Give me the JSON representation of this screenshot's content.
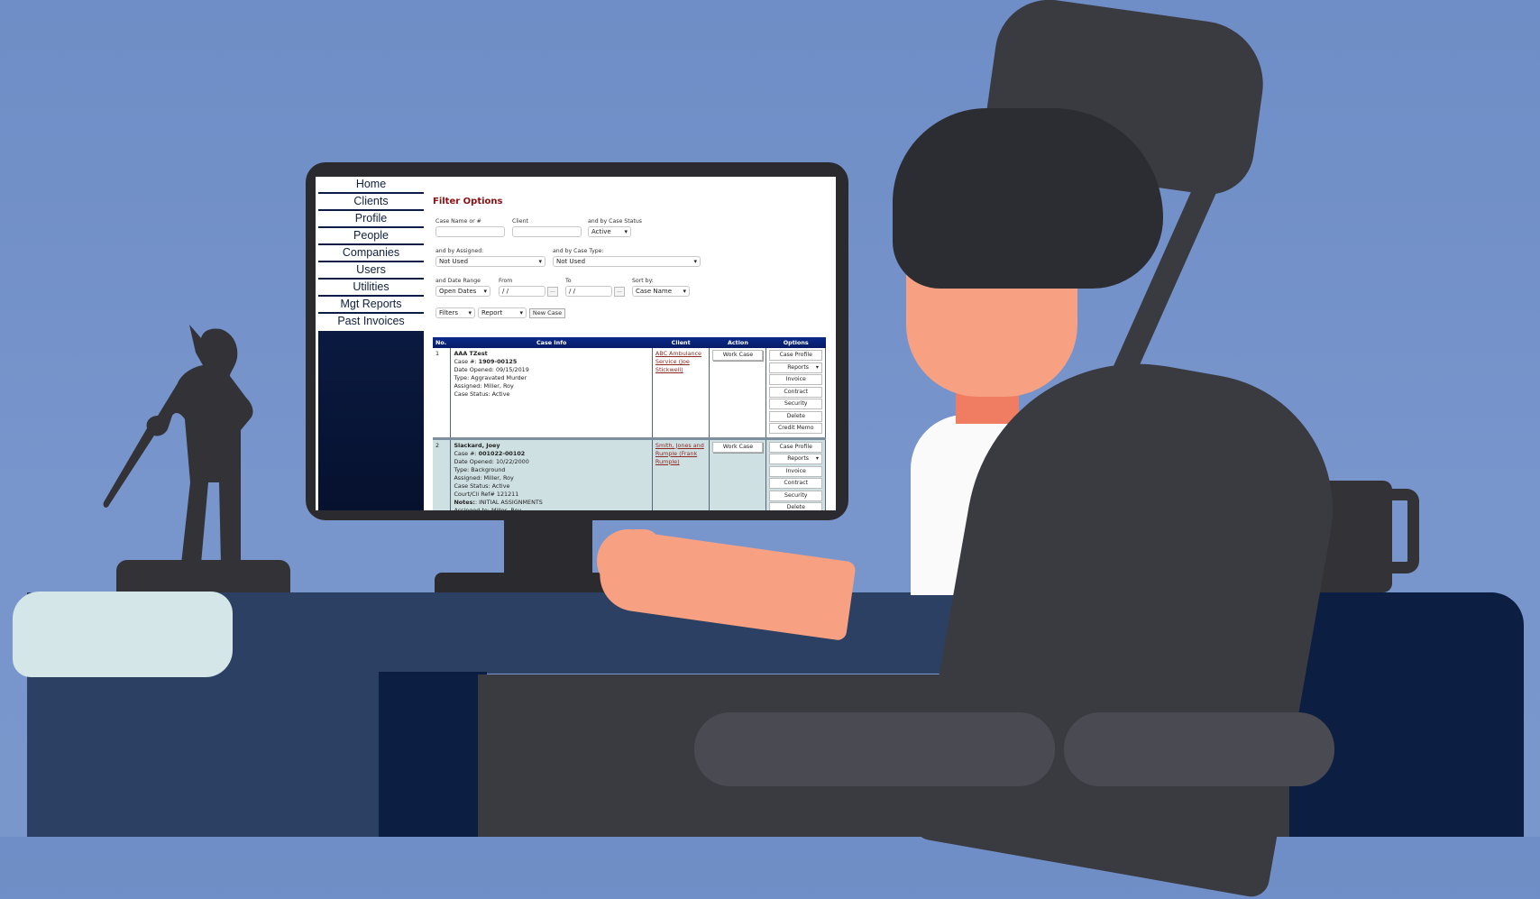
{
  "sidebar": {
    "items": [
      {
        "label": "Home"
      },
      {
        "label": "Clients"
      },
      {
        "label": "Profile"
      },
      {
        "label": "People"
      },
      {
        "label": "Companies"
      },
      {
        "label": "Users"
      },
      {
        "label": "Utilities"
      },
      {
        "label": "Mgt Reports"
      },
      {
        "label": "Past Invoices"
      }
    ]
  },
  "filters": {
    "title": "Filter Options",
    "case_name_label": "Case Name or #",
    "case_name_value": "",
    "client_label": "Client",
    "client_value": "",
    "case_status_label": "and by Case Status",
    "case_status_value": "Active",
    "assigned_label": "and by Assigned:",
    "assigned_value": "Not Used",
    "case_type_label": "and by Case Type:",
    "case_type_value": "Not Used",
    "date_range_label": "and Date Range",
    "date_range_value": "Open Dates",
    "from_label": "From",
    "from_value": " /  /",
    "to_label": "To",
    "to_value": " /  /",
    "picker_label": "...",
    "sort_label": "Sort by:",
    "sort_value": "Case Name",
    "filters_select": "Filters",
    "report_select": "Report",
    "new_case_button": "New Case"
  },
  "table": {
    "headers": [
      "No.",
      "Case Info",
      "Client",
      "Action",
      "Options"
    ],
    "action_label": "Work Case",
    "options": [
      "Case Profile",
      "Reports",
      "Invoice",
      "Contract",
      "Security",
      "Delete",
      "Credit Memo"
    ],
    "rows": [
      {
        "no": "1",
        "name": "AAA TZest",
        "case_no_label": "Case #: ",
        "case_no": "1909-00125",
        "date_opened": "Date Opened: 09/15/2019",
        "type": "Type: Aggravated Murder",
        "assigned": "Assigned: Miller, Roy",
        "status": "Case Status: Active",
        "court_ref": "",
        "notes_label": "",
        "notes": "",
        "assigned_to": "",
        "client": "ABC Ambulance Service (Joe Stickwell)"
      },
      {
        "no": "2",
        "name": "Slackard, Joey",
        "case_no_label": "Case #: ",
        "case_no": "001022-00102",
        "date_opened": "Date Opened: 10/22/2000",
        "type": "Type: Background",
        "assigned": "Assigned: Miller, Roy",
        "status": "Case Status: Active",
        "court_ref": "Court/Cli Ref# 121211",
        "notes_label": "Notes:",
        "notes": ": INITIAL ASSIGNMENTS",
        "assigned_to": "Assinged to: Miller, Roy",
        "client": "Smith, Jones and Rumple (Frank Rumple)"
      }
    ]
  },
  "colors": {
    "background": "#7391c8",
    "sidebar_dark": "#0b1a45",
    "table_header": "#0b2a8a",
    "filter_title": "#8b0f10",
    "link": "#8e2a24",
    "row_alt": "#cfe0e3"
  }
}
